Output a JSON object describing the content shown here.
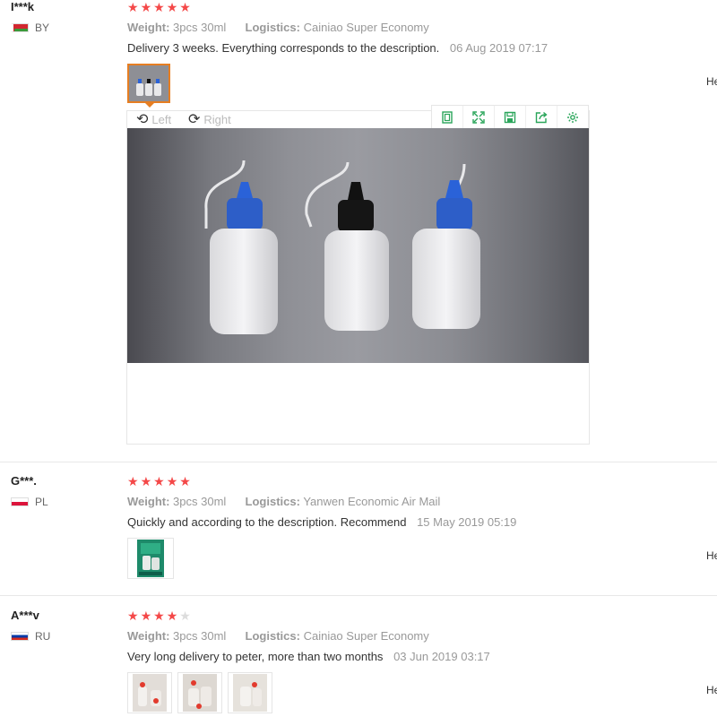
{
  "reviews": [
    {
      "user": "I***k",
      "country": "BY",
      "rating": 5,
      "weight_label": "Weight:",
      "weight_value": "3pcs 30ml",
      "logistics_label": "Logistics:",
      "logistics_value": "Cainiao Super Economy",
      "comment": "Delivery 3 weeks. Everything corresponds to the description.",
      "date": "06 Aug 2019 07:17",
      "helpful": "He"
    },
    {
      "user": "G***.",
      "country": "PL",
      "rating": 5,
      "weight_label": "Weight:",
      "weight_value": "3pcs 30ml",
      "logistics_label": "Logistics:",
      "logistics_value": "Yanwen Economic Air Mail",
      "comment": "Quickly and according to the description. Recommend",
      "date": "15 May 2019 05:19",
      "helpful": "He"
    },
    {
      "user": "A***v",
      "country": "RU",
      "rating": 4,
      "weight_label": "Weight:",
      "weight_value": "3pcs 30ml",
      "logistics_label": "Logistics:",
      "logistics_value": "Cainiao Super Economy",
      "comment": "Very long delivery to peter, more than two months",
      "date": "03 Jun 2019 03:17",
      "helpful": "He"
    }
  ],
  "viewer": {
    "rotate_left": "Left",
    "rotate_right": "Right",
    "tools": [
      "fit-icon",
      "fullscreen-icon",
      "save-icon",
      "share-icon",
      "settings-icon"
    ]
  },
  "colors": {
    "star": "#f44848",
    "star_off": "#dcdcdc",
    "accent": "#e67e22",
    "tool_icon": "#2aa55a"
  }
}
